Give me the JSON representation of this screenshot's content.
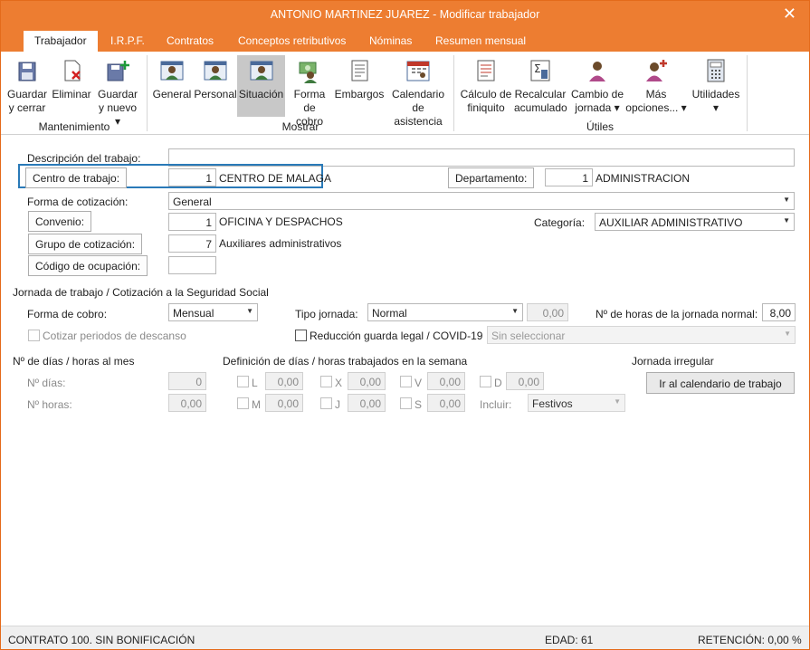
{
  "window": {
    "title": "ANTONIO MARTINEZ JUAREZ - Modificar trabajador"
  },
  "tabs": [
    "Trabajador",
    "I.R.P.F.",
    "Contratos",
    "Conceptos retributivos",
    "Nóminas",
    "Resumen mensual"
  ],
  "ribbon": {
    "groups": {
      "mantenimiento": "Mantenimiento",
      "mostrar": "Mostrar",
      "utiles": "Útiles"
    },
    "buttons": {
      "guardar_cerrar": [
        "Guardar",
        "y cerrar"
      ],
      "eliminar": "Eliminar",
      "guardar_nuevo": [
        "Guardar",
        "y nuevo ▾"
      ],
      "general": "General",
      "personal": "Personal",
      "situacion": "Situación",
      "forma_cobro": [
        "Forma",
        "de cobro"
      ],
      "embargos": "Embargos",
      "calendario": [
        "Calendario",
        "de asistencia"
      ],
      "finiquito": [
        "Cálculo de",
        "finiquito"
      ],
      "recalcular": [
        "Recalcular",
        "acumulado"
      ],
      "cambio_jornada": [
        "Cambio de",
        "jornada ▾"
      ],
      "mas_opciones": [
        "Más",
        "opciones... ▾"
      ],
      "utilidades": [
        "Utilidades",
        "▾"
      ]
    }
  },
  "form": {
    "descripcion_label": "Descripción del trabajo:",
    "descripcion_value": "",
    "centro_label": "Centro de trabajo:",
    "centro_code": "1",
    "centro_name": "CENTRO DE MALAGA",
    "departamento_label": "Departamento:",
    "departamento_code": "1",
    "departamento_name": "ADMINISTRACION",
    "forma_cotizacion_label": "Forma de cotización:",
    "forma_cotizacion_value": "General",
    "convenio_label": "Convenio:",
    "convenio_code": "1",
    "convenio_name": "OFICINA Y DESPACHOS",
    "categoria_label": "Categoría:",
    "categoria_value": "AUXILIAR ADMINISTRATIVO",
    "grupo_label": "Grupo de cotización:",
    "grupo_code": "7",
    "grupo_name": "Auxiliares administrativos",
    "ocupacion_label": "Código de ocupación:",
    "ocupacion_value": ""
  },
  "jornada": {
    "section_title": "Jornada de trabajo / Cotización a la Seguridad Social",
    "forma_cobro_label": "Forma de cobro:",
    "forma_cobro_value": "Mensual",
    "tipo_jornada_label": "Tipo jornada:",
    "tipo_jornada_value": "Normal",
    "tipo_jornada_pct": "0,00",
    "horas_label": "Nº de horas de la jornada normal:",
    "horas_value": "8,00",
    "cotizar_label": "Cotizar periodos de descanso",
    "reduccion_label": "Reducción guarda legal / COVID-19",
    "reduccion_select": "Sin seleccionar"
  },
  "dias": {
    "title": "Nº de días / horas al mes",
    "dias_label": "Nº días:",
    "dias_value": "0",
    "horas_label": "Nº horas:",
    "horas_value": "0,00",
    "semana_title": "Definición de días / horas trabajados en la semana",
    "days": [
      {
        "letter": "L",
        "value": "0,00"
      },
      {
        "letter": "X",
        "value": "0,00"
      },
      {
        "letter": "V",
        "value": "0,00"
      },
      {
        "letter": "D",
        "value": "0,00"
      },
      {
        "letter": "M",
        "value": "0,00"
      },
      {
        "letter": "J",
        "value": "0,00"
      },
      {
        "letter": "S",
        "value": "0,00"
      }
    ],
    "incluir_label": "Incluir:",
    "incluir_value": "Festivos",
    "irregular_title": "Jornada irregular",
    "calendario_button": "Ir al calendario de trabajo"
  },
  "status": {
    "contrato": "CONTRATO 100.  SIN BONIFICACIÓN",
    "edad": "EDAD: 61",
    "retencion": "RETENCIÓN: 0,00 %"
  },
  "colors": {
    "accent": "#ed7d31",
    "highlight": "#2a7ab8"
  }
}
